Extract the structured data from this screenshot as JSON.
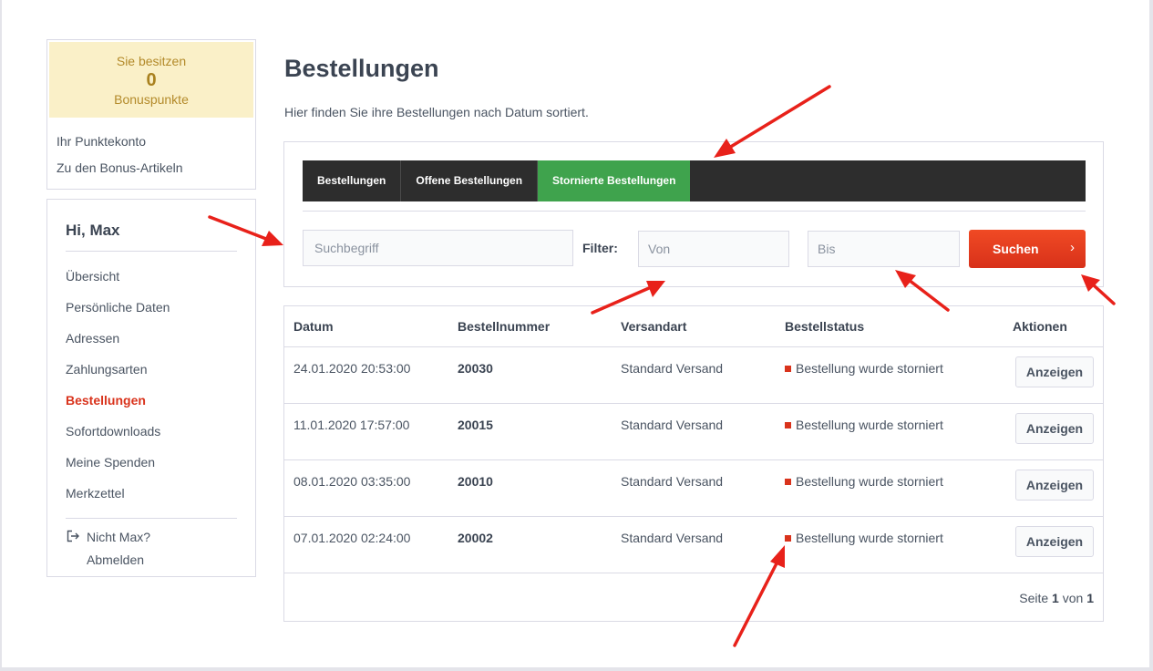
{
  "bonus": {
    "line1": "Sie besitzen",
    "points": "0",
    "line2": "Bonuspunkte",
    "links": [
      "Ihr Punktekonto",
      "Zu den Bonus-Artikeln"
    ]
  },
  "account": {
    "greeting": "Hi, Max",
    "nav": [
      {
        "label": "Übersicht",
        "active": false
      },
      {
        "label": "Persönliche Daten",
        "active": false
      },
      {
        "label": "Adressen",
        "active": false
      },
      {
        "label": "Zahlungsarten",
        "active": false
      },
      {
        "label": "Bestellungen",
        "active": true
      },
      {
        "label": "Sofortdownloads",
        "active": false
      },
      {
        "label": "Meine Spenden",
        "active": false
      },
      {
        "label": "Merkzettel",
        "active": false
      }
    ],
    "logout_line1": "Nicht Max?",
    "logout_line2": "Abmelden",
    "logout_icon": "logout-icon"
  },
  "main": {
    "title": "Bestellungen",
    "description": "Hier finden Sie ihre Bestellungen nach Datum sortiert.",
    "tabs": [
      {
        "label": "Bestellungen",
        "active": false
      },
      {
        "label": "Offene Bestellungen",
        "active": false
      },
      {
        "label": "Stornierte Bestellungen",
        "active": true
      }
    ],
    "search_placeholder": "Suchbegriff",
    "search_value": "",
    "filter_label": "Filter:",
    "from_placeholder": "Von",
    "to_placeholder": "Bis",
    "search_button": "Suchen",
    "search_button_icon": "chevron-right-icon"
  },
  "table": {
    "headers": [
      "Datum",
      "Bestellnummer",
      "Versandart",
      "Bestellstatus",
      "Aktionen"
    ],
    "rows": [
      {
        "date": "24.01.2020 20:53:00",
        "number": "20030",
        "shipping": "Standard Versand",
        "status": "Bestellung wurde storniert",
        "action": "Anzeigen"
      },
      {
        "date": "11.01.2020 17:57:00",
        "number": "20015",
        "shipping": "Standard Versand",
        "status": "Bestellung wurde storniert",
        "action": "Anzeigen"
      },
      {
        "date": "08.01.2020 03:35:00",
        "number": "20010",
        "shipping": "Standard Versand",
        "status": "Bestellung wurde storniert",
        "action": "Anzeigen"
      },
      {
        "date": "07.01.2020 02:24:00",
        "number": "20002",
        "shipping": "Standard Versand",
        "status": "Bestellung wurde storniert",
        "action": "Anzeigen"
      }
    ],
    "pagination": {
      "prefix": "Seite",
      "current": "1",
      "sep": "von",
      "total": "1"
    }
  },
  "colors": {
    "accent_red": "#d9331c",
    "tab_green": "#3fa34d",
    "tabbar_dark": "#2d2d2d",
    "bonus_bg": "#faf0c8",
    "annotation_arrow": "#e8211a"
  }
}
